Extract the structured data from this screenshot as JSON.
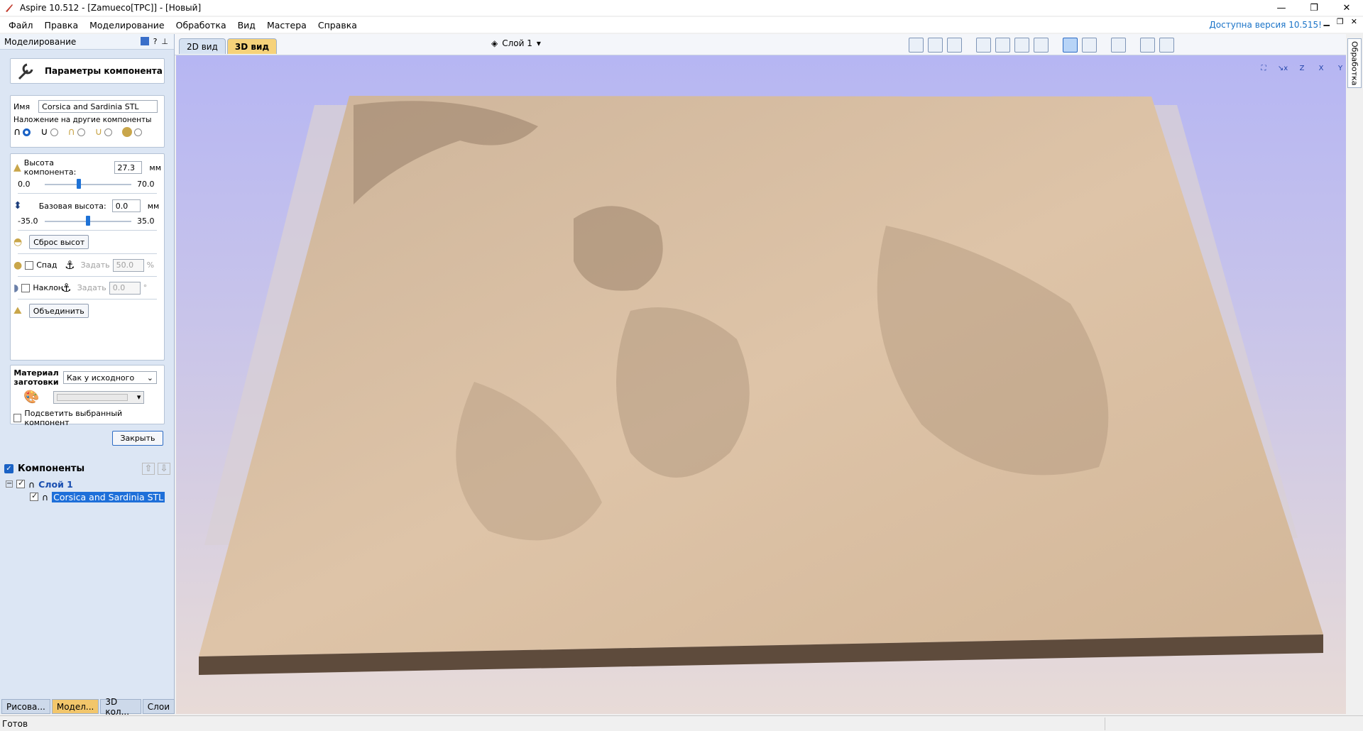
{
  "window": {
    "title": "Aspire 10.512 - [Zamueco[TPC]] - [Новый]",
    "minimize": "—",
    "maximize": "❐",
    "close": "✕"
  },
  "menu": {
    "items": [
      "Файл",
      "Правка",
      "Моделирование",
      "Обработка",
      "Вид",
      "Мастера",
      "Справка"
    ],
    "update_notice": "Доступна версия 10.515!"
  },
  "left_panel": {
    "header": "Моделирование",
    "header_icons": [
      "?",
      "📌"
    ],
    "component_params_button": "Параметры компонента",
    "name_label": "Имя",
    "name_value": "Corsica and Sardinia STL",
    "overlay_label": "Наложение на другие компоненты",
    "height_label": "Высота компонента:",
    "height_value": "27.3",
    "height_unit": "мм",
    "height_min": "0.0",
    "height_max": "70.0",
    "height_slider_fraction": 0.39,
    "base_label": "Базовая высота:",
    "base_value": "0.0",
    "base_unit": "мм",
    "base_min": "-35.0",
    "base_max": "35.0",
    "base_slider_fraction": 0.5,
    "reset_button": "Сброс высот",
    "fade_label": "Спад",
    "fade_set": "Задать",
    "fade_value": "50.0",
    "fade_unit": "%",
    "tilt_label": "Наклон",
    "tilt_set": "Задать",
    "tilt_value": "0.0",
    "tilt_unit": "°",
    "merge_button": "Объединить",
    "material_label_1": "Материал",
    "material_label_2": "заготовки",
    "material_select": "Как у исходного",
    "highlight_label": "Подсветить выбранный компонент",
    "close_button": "Закрыть"
  },
  "components": {
    "title": "Компоненты",
    "layer_name": "Слой 1",
    "item_name": "Corsica and Sardinia STL"
  },
  "bottom_tabs": [
    "Рисова...",
    "Модел...",
    "3D кол...",
    "Слои"
  ],
  "view": {
    "tab_2d": "2D вид",
    "tab_3d": "3D вид",
    "layer_select": "Слой 1",
    "right_tab": "Обработка",
    "axis_icons": [
      "⛶",
      "↘x",
      "Z",
      "X",
      "Y"
    ]
  },
  "status": {
    "text": "Готов"
  },
  "colors": {
    "panel_bg": "#dce6f4",
    "accent_tab": "#f2c66b",
    "terrain": "#dcbfa3",
    "terrain_side": "#5e4b3c"
  }
}
